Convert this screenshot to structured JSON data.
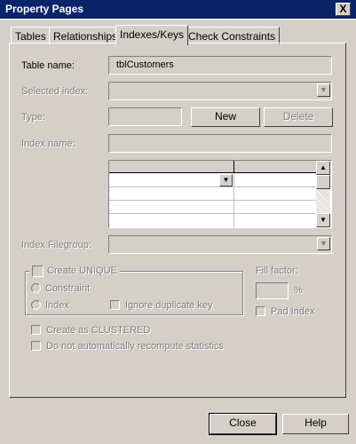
{
  "window": {
    "title": "Property Pages",
    "close_glyph": "X"
  },
  "tabs": [
    {
      "label": "Tables"
    },
    {
      "label": "Relationships"
    },
    {
      "label": "Indexes/Keys"
    },
    {
      "label": "Check Constraints"
    }
  ],
  "form": {
    "table_name_label": "Table name:",
    "table_name_value": "tblCustomers",
    "selected_index_label": "Selected index:",
    "type_label": "Type:",
    "new_button": "New",
    "delete_button": "Delete",
    "index_name_label": "Index name:",
    "index_filegroup_label": "Index Filegroup:",
    "create_unique_label": "Create UNIQUE",
    "constraint_label": "Constraint",
    "index_label": "Index",
    "ignore_duplicate_label": "Ignore duplicate key",
    "fill_factor_label": "Fill factor:",
    "percent_label": "%",
    "pad_index_label": "Pad Index",
    "create_clustered_label": "Create as CLUSTERED",
    "no_recompute_label": "Do not automatically recompute statistics"
  },
  "grid": {
    "rows": 5
  },
  "footer": {
    "close_button": "Close",
    "help_button": "Help"
  }
}
